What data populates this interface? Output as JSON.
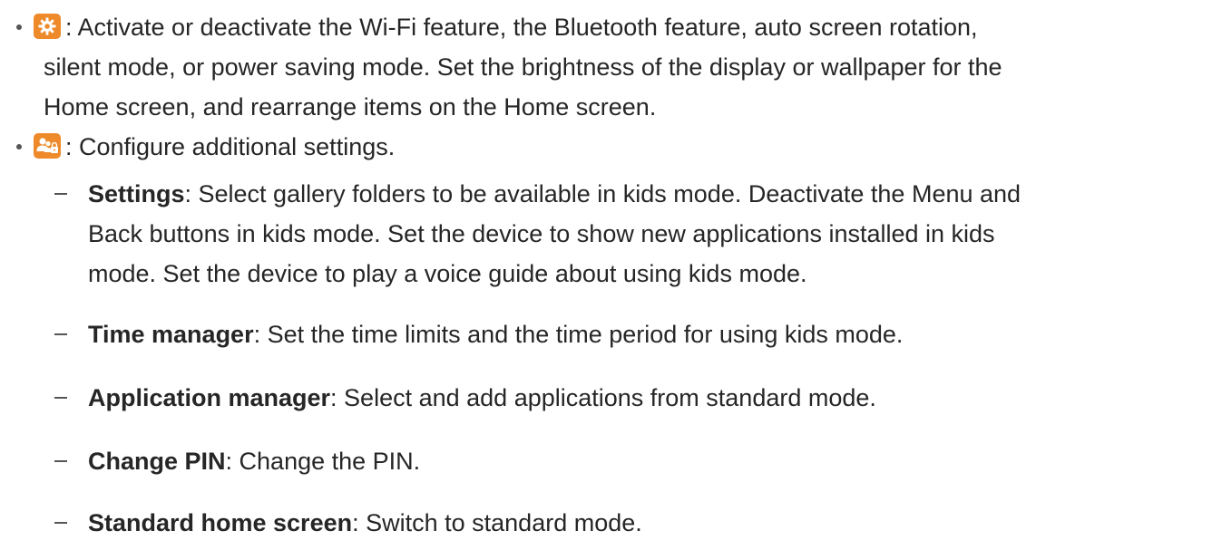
{
  "items": [
    {
      "icon": "gear-icon",
      "lines": [
        ": Activate or deactivate the Wi-Fi feature, the Bluetooth feature, auto screen rotation,",
        "silent mode, or power saving mode. Set the brightness of the display or wallpaper for the",
        "Home screen, and rearrange items on the Home screen."
      ]
    },
    {
      "icon": "parental-lock-icon",
      "lines": [
        ": Configure additional settings."
      ]
    }
  ],
  "sub_items": [
    {
      "term": "Settings",
      "lines": [
        ": Select gallery folders to be available in kids mode. Deactivate the Menu and",
        "Back buttons in kids mode. Set the device to show new applications installed in kids",
        "mode. Set the device to play a voice guide about using kids mode."
      ]
    },
    {
      "term": "Time manager",
      "lines": [
        ": Set the time limits and the time period for using kids mode."
      ]
    },
    {
      "term": "Application manager",
      "lines": [
        ": Select and add applications from standard mode."
      ]
    },
    {
      "term": "Change PIN",
      "lines": [
        ": Change the PIN."
      ]
    },
    {
      "term": "Standard home screen",
      "lines": [
        ": Switch to standard mode."
      ]
    }
  ],
  "colors": {
    "icon_background": "#ee8a2a",
    "text": "#262626"
  }
}
